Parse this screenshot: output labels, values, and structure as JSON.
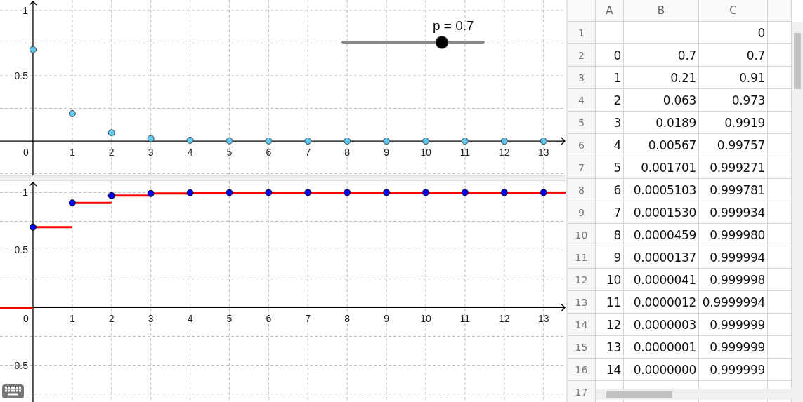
{
  "graphics_top": {
    "slider": {
      "label": "p = 0.7",
      "level": 0.7
    },
    "origin_label": "0",
    "chart_data": {
      "type": "scatter",
      "grid": true,
      "x": [
        0,
        1,
        2,
        3,
        4,
        5,
        6,
        7,
        8,
        9,
        10,
        11,
        12,
        13
      ],
      "xlim": [
        -0.84,
        13.56
      ],
      "ylim": [
        -0.263,
        1.08
      ],
      "xticks": [
        1,
        2,
        3,
        4,
        5,
        6,
        7,
        8,
        9,
        10,
        11,
        12,
        13
      ],
      "yticks": [
        0.5,
        1
      ],
      "series": [
        {
          "color": "#5ec8f5",
          "values": [
            0.7,
            0.21,
            0.063,
            0.019,
            0.006,
            0.002,
            0.001,
            0,
            0,
            0,
            0,
            0,
            0,
            0
          ]
        }
      ]
    }
  },
  "graphics_bottom": {
    "kind": "step",
    "origin_label": "0",
    "chart_data": {
      "type": "scatter",
      "grid": true,
      "x": [
        0,
        1,
        2,
        3,
        4,
        5,
        6,
        7,
        8,
        9,
        10,
        11,
        12,
        13
      ],
      "xlim": [
        -0.84,
        13.56
      ],
      "ylim": [
        -0.82,
        1.1
      ],
      "xticks": [
        1,
        2,
        3,
        4,
        5,
        6,
        7,
        8,
        9,
        10,
        11,
        12,
        13
      ],
      "yticks": [
        -0.5,
        0.5,
        1
      ],
      "series": [
        {
          "color": "#0000ff",
          "values": [
            0.7,
            0.91,
            0.973,
            0.992,
            0.998,
            0.999,
            1,
            1,
            1,
            1,
            1,
            1,
            1,
            1
          ]
        }
      ]
    }
  },
  "spreadsheet": {
    "columns": [
      "A",
      "B",
      "C"
    ],
    "rows": [
      {
        "row": "1",
        "cells": [
          "",
          "",
          "0"
        ]
      },
      {
        "row": "2",
        "cells": [
          "0",
          "0.7",
          "0.7"
        ]
      },
      {
        "row": "3",
        "cells": [
          "1",
          "0.21",
          "0.91"
        ]
      },
      {
        "row": "4",
        "cells": [
          "2",
          "0.063",
          "0.973"
        ]
      },
      {
        "row": "5",
        "cells": [
          "3",
          "0.0189",
          "0.9919"
        ]
      },
      {
        "row": "6",
        "cells": [
          "4",
          "0.00567",
          "0.99757"
        ]
      },
      {
        "row": "7",
        "cells": [
          "5",
          "0.001701",
          "0.999271"
        ]
      },
      {
        "row": "8",
        "cells": [
          "6",
          "0.0005103",
          "0.999781"
        ]
      },
      {
        "row": "9",
        "cells": [
          "7",
          "0.0001530",
          "0.999934"
        ]
      },
      {
        "row": "10",
        "cells": [
          "8",
          "0.0000459",
          "0.999980"
        ]
      },
      {
        "row": "11",
        "cells": [
          "9",
          "0.0000137",
          "0.999994"
        ]
      },
      {
        "row": "12",
        "cells": [
          "10",
          "0.0000041",
          "0.999998"
        ]
      },
      {
        "row": "13",
        "cells": [
          "11",
          "0.0000012",
          "0.9999994"
        ]
      },
      {
        "row": "14",
        "cells": [
          "12",
          "0.0000003",
          "0.999999"
        ]
      },
      {
        "row": "15",
        "cells": [
          "13",
          "0.0000001",
          "0.999999"
        ]
      },
      {
        "row": "16",
        "cells": [
          "14",
          "0.0000000",
          "0.999999"
        ]
      },
      {
        "row": "17",
        "cells": []
      }
    ]
  }
}
